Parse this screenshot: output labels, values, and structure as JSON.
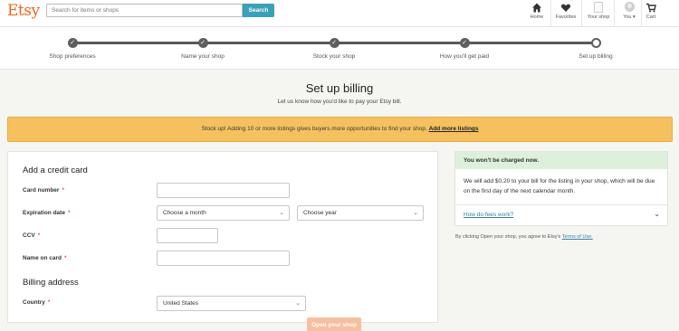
{
  "header": {
    "logo": "Etsy",
    "search_placeholder": "Search for items or shops",
    "search_button": "Search",
    "nav": {
      "home": "Home",
      "favorites": "Favorites",
      "your_shop": "Your shop",
      "you": "You",
      "cart": "Cart"
    }
  },
  "steps": [
    {
      "label": "Shop preferences",
      "state": "done"
    },
    {
      "label": "Name your shop",
      "state": "done"
    },
    {
      "label": "Stock your shop",
      "state": "done"
    },
    {
      "label": "How you'll get paid",
      "state": "done"
    },
    {
      "label": "Set up billing",
      "state": "current"
    }
  ],
  "page": {
    "title": "Set up billing",
    "subtitle": "Let us know how you'd like to pay your Etsy bill."
  },
  "banner": {
    "text": "Stock up! Adding 10 or more listings gives buyers more opportunities to find your shop.",
    "link": "Add more listings"
  },
  "form": {
    "credit_card_title": "Add a credit card",
    "card_number_label": "Card number",
    "expiration_label": "Expiration date",
    "month_select": "Choose a month",
    "year_select": "Choose year",
    "ccv_label": "CCV",
    "name_label": "Name on card",
    "billing_title": "Billing address",
    "country_label": "Country",
    "country_value": "United States",
    "required_mark": "*"
  },
  "info": {
    "header": "You won't be charged now.",
    "body": "We will add $0.20 to your bill for the listing in your shop, which will be due on the first day of the next calendar month.",
    "fees_link": "How do fees work?"
  },
  "terms": {
    "text": "By clicking Open your shop, you agree to Etsy's",
    "link": "Terms of Use."
  },
  "open_shop_button": "Open your shop",
  "colors": {
    "brand": "#f1641e",
    "search_button": "#3aa1b9",
    "banner": "#f5c15f",
    "info_header": "#ddf0db",
    "open_button": "#f7bfa0"
  }
}
